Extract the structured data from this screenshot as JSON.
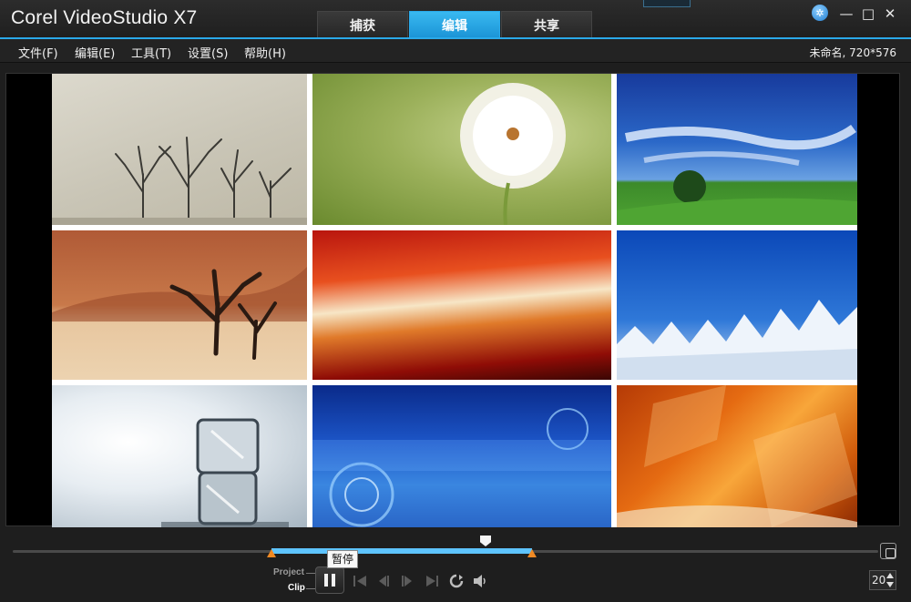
{
  "window": {
    "title": "Corel VideoStudio X7",
    "settings_icon": "snowflake-gear-icon",
    "minimize_glyph": "—",
    "maximize_glyph": "□",
    "close_glyph": "✕"
  },
  "tabs": [
    {
      "label": "捕获",
      "active": false
    },
    {
      "label": "编辑",
      "active": true
    },
    {
      "label": "共享",
      "active": false
    }
  ],
  "menu": {
    "items": [
      "文件(F)",
      "编辑(E)",
      "工具(T)",
      "设置(S)",
      "帮助(H)"
    ],
    "project_info": "未命名, 720*576"
  },
  "preview": {
    "thumbnails": [
      "misty-trees",
      "dandelion",
      "blue-sky-tree",
      "desert-dead-tree",
      "red-light-streaks",
      "snowy-forest",
      "ice-cubes",
      "blue-tech-circles",
      "orange-geometric"
    ]
  },
  "playback": {
    "project_label": "Project",
    "clip_label": "Clip",
    "pause_tooltip": "暂停",
    "timecode": "20",
    "trim_start": 0.298,
    "trim_end": 0.584,
    "scrubber_position": 0.532
  },
  "colors": {
    "accent": "#2aa9e9",
    "trim_range": "#5ec4ff",
    "trim_marker": "#f08a24"
  }
}
